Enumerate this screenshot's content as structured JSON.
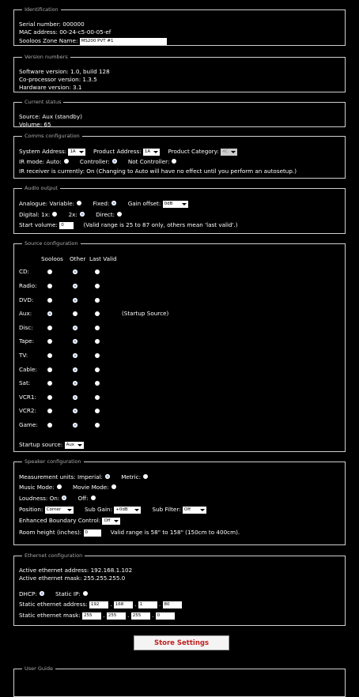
{
  "identification": {
    "legend": "Identification",
    "serial": "Serial number: 000000",
    "mac": "MAC address: 00-24-c5-00-05-ef",
    "zone_label": "Sooloos Zone Name:",
    "zone_value": "MS200 PVT #1"
  },
  "versions": {
    "legend": "Version numbers",
    "software": "Software version: 1.0, build 128",
    "coprocessor": "Co-processor version: 1.3.5",
    "hardware": "Hardware version: 3.1"
  },
  "status": {
    "legend": "Current status",
    "source": "Source: Aux (standby)",
    "volume": "Volume: 65"
  },
  "comms": {
    "legend": "Comms configuration",
    "system_address_label": "System Address:",
    "system_address_value": "1A",
    "product_address_label": "Product Address:",
    "product_address_value": "1A",
    "product_category_label": "Product Category:",
    "product_category_value": "4C",
    "ir_mode_label": "IR mode:",
    "ir_auto": "Auto:",
    "ir_controller": "Controller:",
    "ir_not_controller": "Not Controller:",
    "ir_receiver_text": "IR receiver is currently: On (Changing to Auto will have no effect until you perform an autosetup.)"
  },
  "audio": {
    "legend": "Audio output",
    "analogue_label": "Analogue:",
    "variable": "Variable:",
    "fixed": "Fixed:",
    "gain_offset_label": "Gain offset:",
    "gain_offset_value": "0dB",
    "digital_label": "Digital:",
    "d1x": "1x:",
    "d2x": "2x:",
    "direct": "Direct:",
    "start_volume_label": "Start volume:",
    "start_volume_value": "0",
    "valid_range": "(Valid range is 25 to 87 only, others mean 'last valid'.)"
  },
  "source": {
    "legend": "Source configuration",
    "headers": [
      "Sooloos",
      "Other",
      "Last Valid"
    ],
    "rows": [
      {
        "name": "CD:",
        "sel": 1,
        "note": ""
      },
      {
        "name": "Radio:",
        "sel": 1,
        "note": ""
      },
      {
        "name": "DVD:",
        "sel": 1,
        "note": ""
      },
      {
        "name": "Aux:",
        "sel": 0,
        "note": "(Startup Source)"
      },
      {
        "name": "Disc:",
        "sel": 1,
        "note": ""
      },
      {
        "name": "Tape:",
        "sel": 1,
        "note": ""
      },
      {
        "name": "TV:",
        "sel": 1,
        "note": ""
      },
      {
        "name": "Cable:",
        "sel": 1,
        "note": ""
      },
      {
        "name": "Sat:",
        "sel": 1,
        "note": ""
      },
      {
        "name": "VCR1:",
        "sel": 1,
        "note": ""
      },
      {
        "name": "VCR2:",
        "sel": 1,
        "note": ""
      },
      {
        "name": "Game:",
        "sel": 1,
        "note": ""
      }
    ],
    "startup_label": "Startup source:",
    "startup_value": "Aux"
  },
  "speaker": {
    "legend": "Speaker configuration",
    "measurement_label": "Measurement units:",
    "imperial": "Imperial:",
    "metric": "Metric:",
    "music_mode": "Music Mode:",
    "movie_mode": "Movie Mode:",
    "loudness_label": "Loudness:",
    "on": "On:",
    "off": "Off:",
    "position_label": "Position:",
    "position_value": "Corner",
    "sub_gain_label": "Sub Gain:",
    "sub_gain_value": "+0dB",
    "sub_filter_label": "Sub Filter:",
    "sub_filter_value": "Off",
    "ebc_label": "Enhanced Boundary Control:",
    "ebc_value": "Off",
    "room_height_label": "Room height (inches):",
    "room_height_value": "0",
    "room_height_note": "Valid range is 58\" to 158\" (150cm to 400cm)."
  },
  "ethernet": {
    "legend": "Ethernet configuration",
    "active_address": "Active ethernet address: 192.168.1.102",
    "active_mask": "Active ethernet mask: 255.255.255.0",
    "dhcp": "DHCP:",
    "static_ip": "Static IP:",
    "static_address_label": "Static ethernet address:",
    "static_address": [
      "192",
      "168",
      "1",
      "80"
    ],
    "static_mask_label": "Static ethernet mask:",
    "static_mask": [
      "255",
      "255",
      "255",
      "0"
    ]
  },
  "store_button": "Store Settings",
  "user_guide": {
    "legend": "User Guide"
  }
}
